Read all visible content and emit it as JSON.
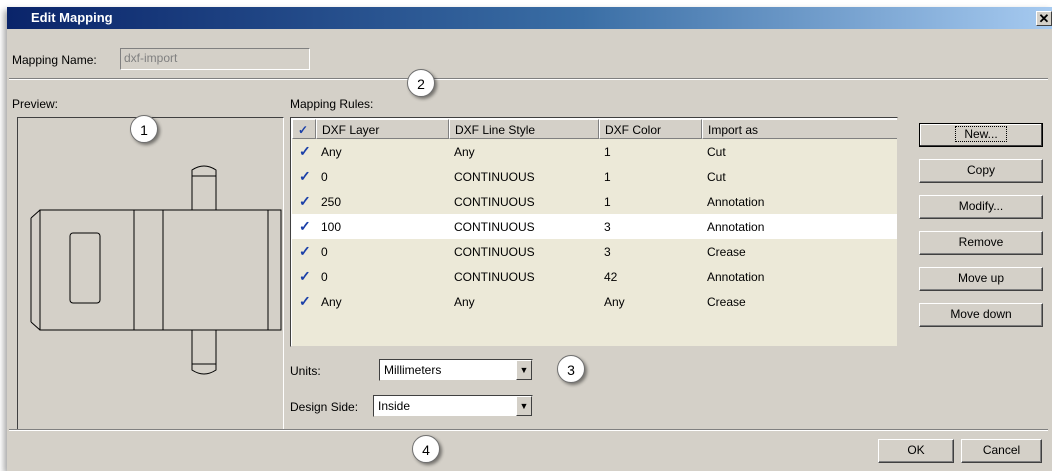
{
  "dialog": {
    "title": "Edit Mapping",
    "close_glyph": "✕"
  },
  "mapping_name": {
    "label": "Mapping Name:",
    "value": "dxf-import"
  },
  "preview": {
    "label": "Preview:"
  },
  "rules": {
    "label": "Mapping Rules:",
    "columns": [
      "✓",
      "DXF Layer",
      "DXF Line Style",
      "DXF Color",
      "Import as"
    ],
    "rows": [
      {
        "checked": "✓",
        "layer": "Any",
        "line_style": "Any",
        "color": "1",
        "import_as": "Cut"
      },
      {
        "checked": "✓",
        "layer": "0",
        "line_style": "CONTINUOUS",
        "color": "1",
        "import_as": "Cut"
      },
      {
        "checked": "✓",
        "layer": "250",
        "line_style": "CONTINUOUS",
        "color": "1",
        "import_as": "Annotation"
      },
      {
        "checked": "✓",
        "layer": "100",
        "line_style": "CONTINUOUS",
        "color": "3",
        "import_as": "Annotation"
      },
      {
        "checked": "✓",
        "layer": "0",
        "line_style": "CONTINUOUS",
        "color": "3",
        "import_as": "Crease"
      },
      {
        "checked": "✓",
        "layer": "0",
        "line_style": "CONTINUOUS",
        "color": "42",
        "import_as": "Annotation"
      },
      {
        "checked": "✓",
        "layer": "Any",
        "line_style": "Any",
        "color": "Any",
        "import_as": "Crease"
      }
    ],
    "selected_row": 3
  },
  "buttons": {
    "new": "New...",
    "copy": "Copy",
    "modify": "Modify...",
    "remove": "Remove",
    "move_up": "Move up",
    "move_down": "Move down",
    "ok": "OK",
    "cancel": "Cancel"
  },
  "units": {
    "label": "Units:",
    "value": "Millimeters"
  },
  "design_side": {
    "label": "Design Side:",
    "value": "Inside"
  },
  "callouts": [
    "1",
    "2",
    "3",
    "4"
  ],
  "colors": {
    "title_gradient_start": "#0a246a",
    "title_gradient_end": "#a6caf0",
    "dialog_bg": "#d4d0c8",
    "check": "#1a3fa8"
  }
}
